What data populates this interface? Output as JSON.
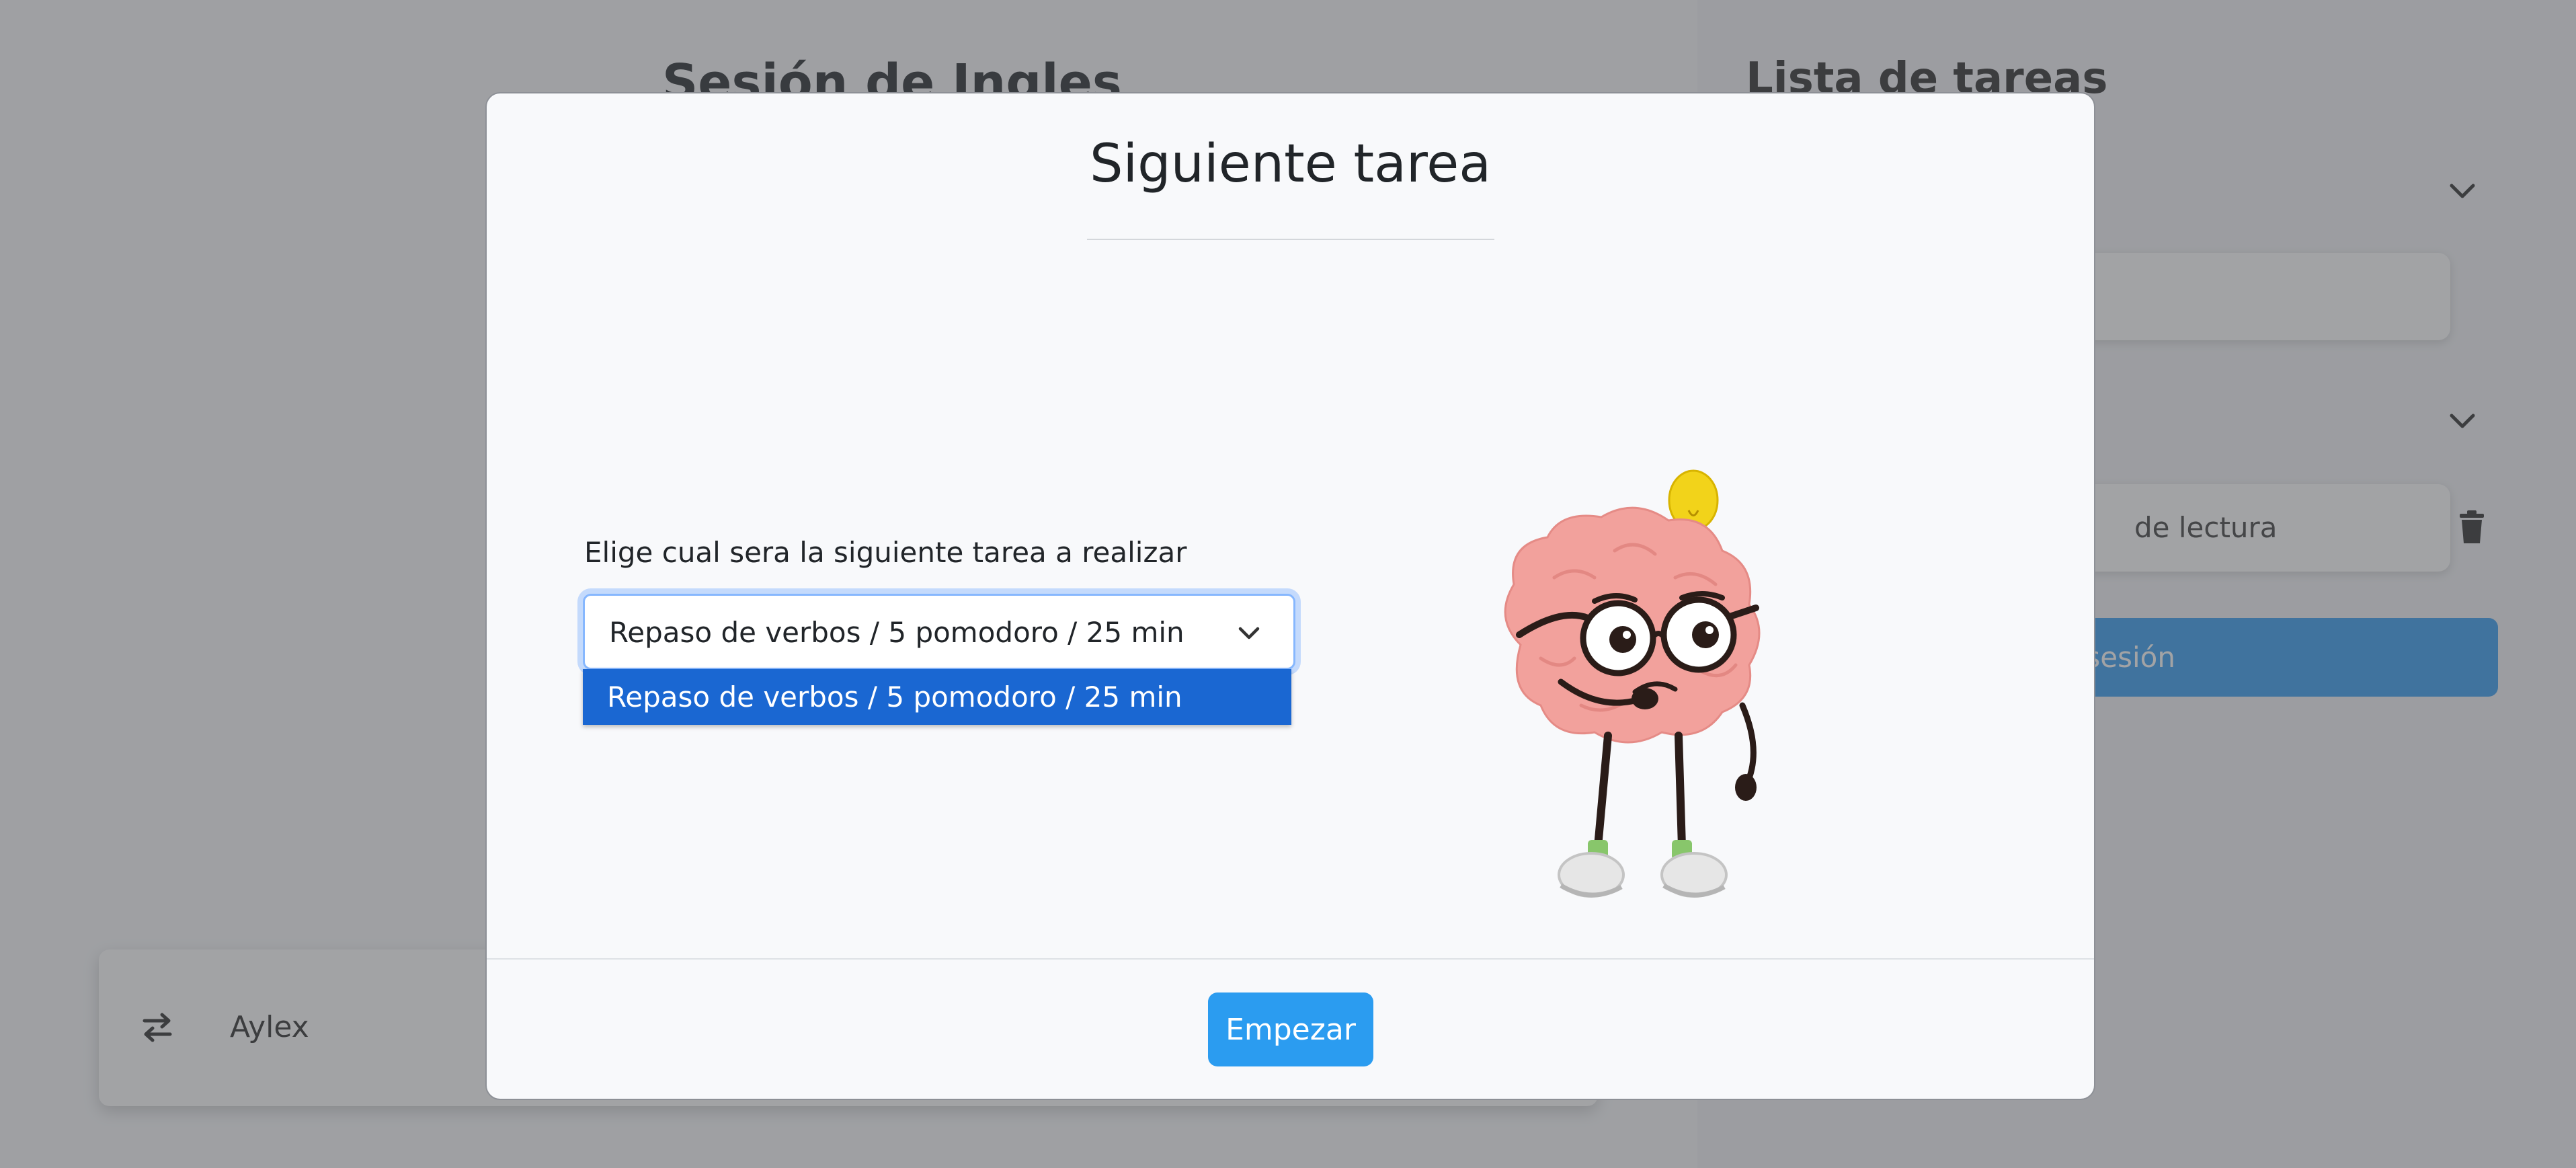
{
  "background": {
    "session_title": "Sesión de Ingles",
    "user_bar": {
      "name": "Aylex",
      "icon": "swap-arrows-icon"
    },
    "sidebar": {
      "title": "Lista de tareas",
      "task_card_2_text": "de lectura",
      "finish_button": "nar sesión"
    }
  },
  "modal": {
    "title": "Siguiente tarea",
    "select_label": "Elige cual sera la siguiente tarea a realizar",
    "select_value": "Repaso de verbos / 5 pomodoro / 25 min",
    "options": [
      "Repaso de verbos / 5 pomodoro / 25 min"
    ],
    "start_button": "Empezar",
    "illustration": "thinking-brain-lightbulb"
  },
  "colors": {
    "primary": "#2b9cf0",
    "option_highlight": "#1a67d2",
    "focus_ring": "#86b7fe"
  }
}
